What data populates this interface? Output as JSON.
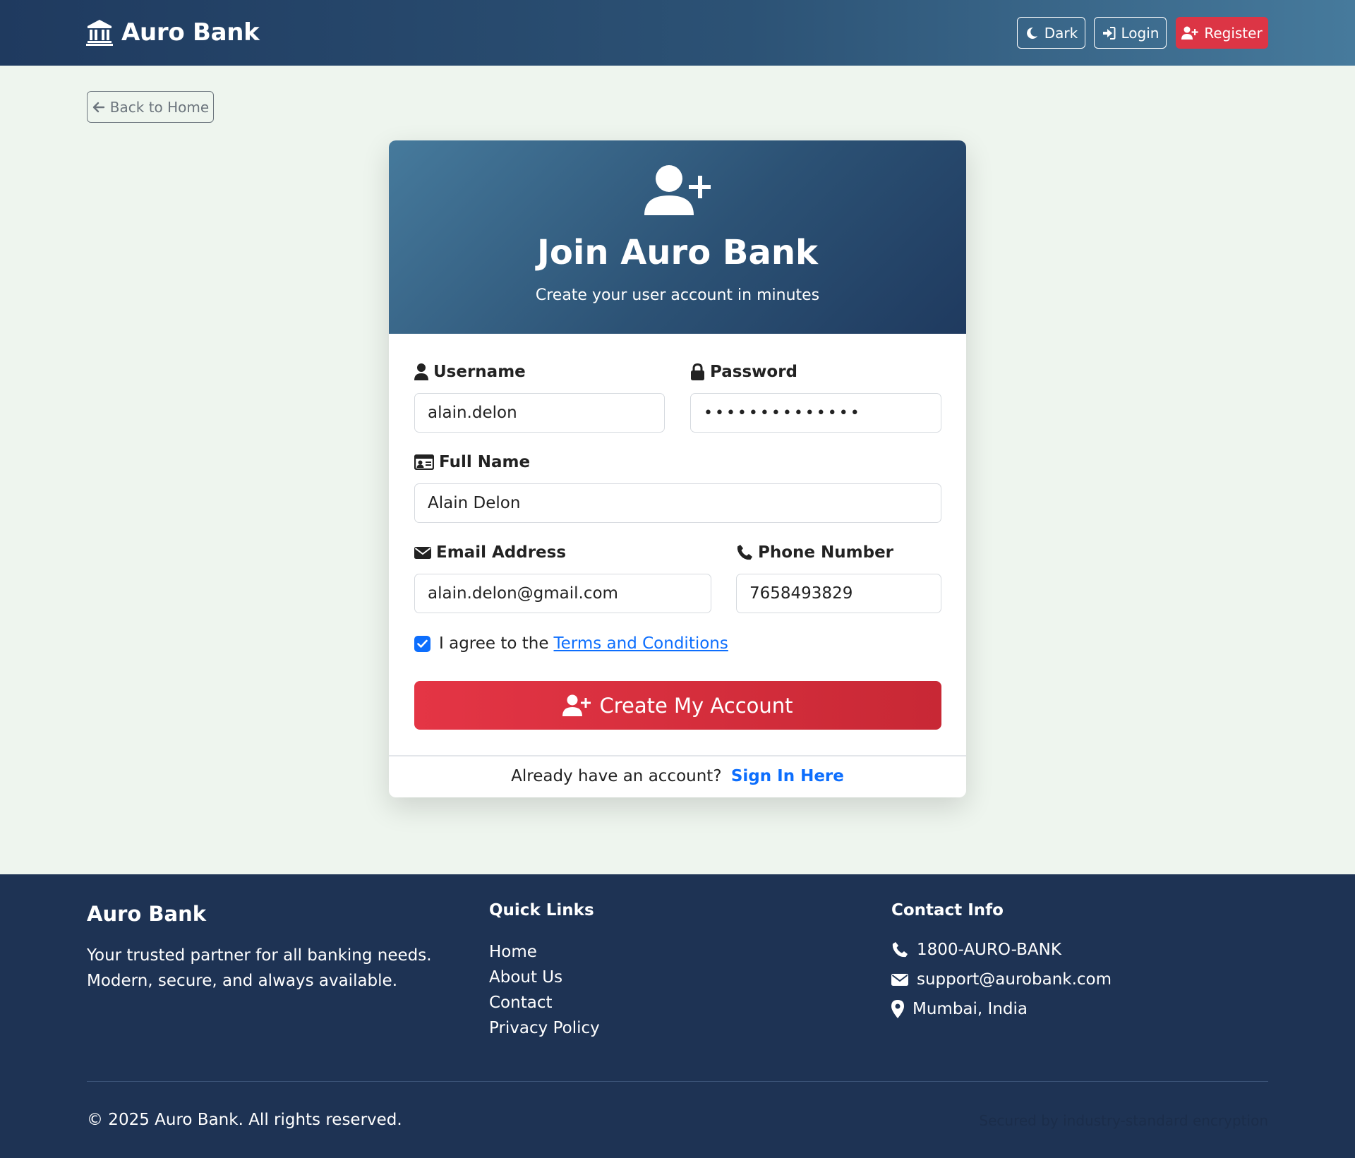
{
  "navbar": {
    "brand": "Auro Bank",
    "dark_label": "Dark",
    "login_label": "Login",
    "register_label": "Register"
  },
  "back_label": "Back to Home",
  "card": {
    "title": "Join Auro Bank",
    "subtitle": "Create your user account in minutes"
  },
  "form": {
    "username_label": "Username",
    "username_value": "alain.delon",
    "password_label": "Password",
    "password_value": "••••••••••••••",
    "fullname_label": "Full Name",
    "fullname_value": "Alain Delon",
    "email_label": "Email Address",
    "email_value": "alain.delon@gmail.com",
    "phone_label": "Phone Number",
    "phone_value": "7658493829",
    "agree_text": "I agree to the",
    "terms_link": "Terms and Conditions",
    "agree_checked": true,
    "submit_label": "Create My Account",
    "signin_prompt": "Already have an account?",
    "signin_link": "Sign In Here"
  },
  "footer": {
    "brand": "Auro Bank",
    "desc_line1": "Your trusted partner for all banking needs.",
    "desc_line2": "Modern, secure, and always available.",
    "quick_links_heading": "Quick Links",
    "quick_links": [
      "Home",
      "About Us",
      "Contact",
      "Privacy Policy"
    ],
    "contact_heading": "Contact Info",
    "phone": "1800-AURO-BANK",
    "email": "support@aurobank.com",
    "location": "Mumbai, India",
    "copyright": "© 2025 Auro Bank. All rights reserved.",
    "secured_text": "Secured by industry-standard encryption"
  },
  "colors": {
    "accent_red": "#dc3545",
    "link_blue": "#0d6efd",
    "navy": "#1e3354"
  }
}
